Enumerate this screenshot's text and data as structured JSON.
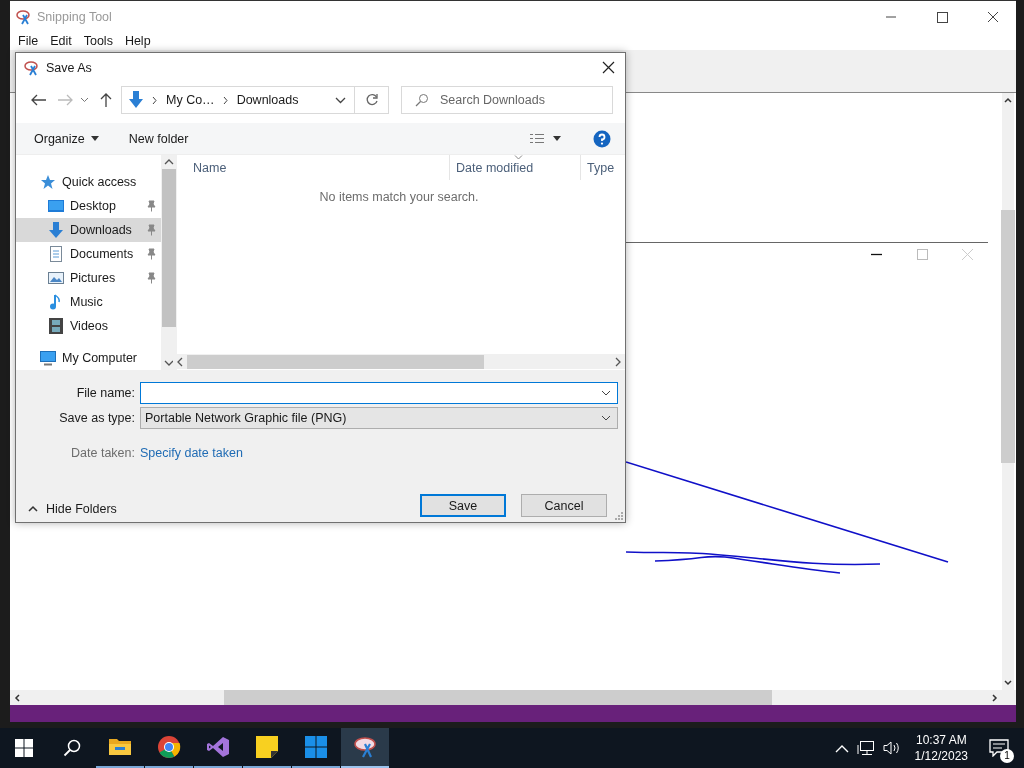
{
  "app_window": {
    "title": "Snipping Tool",
    "menu": [
      "File",
      "Edit",
      "Tools",
      "Help"
    ]
  },
  "dialog": {
    "title": "Save As",
    "address": {
      "crumbs": [
        "My Co…",
        "Downloads"
      ]
    },
    "search": {
      "placeholder": "Search Downloads"
    },
    "commands": {
      "organize": "Organize",
      "new_folder": "New folder"
    },
    "nav_items": [
      {
        "label": "Quick access",
        "kind": "star",
        "pinned": false,
        "selected": false,
        "children": [
          {
            "label": "Desktop",
            "kind": "desktop",
            "pinned": true,
            "selected": false
          },
          {
            "label": "Downloads",
            "kind": "downloads",
            "pinned": true,
            "selected": true
          },
          {
            "label": "Documents",
            "kind": "documents",
            "pinned": true,
            "selected": false
          },
          {
            "label": "Pictures",
            "kind": "pictures",
            "pinned": true,
            "selected": false
          },
          {
            "label": "Music",
            "kind": "music",
            "pinned": false,
            "selected": false
          },
          {
            "label": "Videos",
            "kind": "videos",
            "pinned": false,
            "selected": false
          }
        ]
      },
      {
        "label": "My Computer",
        "kind": "computer",
        "pinned": false,
        "selected": false
      }
    ],
    "columns": [
      {
        "label": "Name",
        "sorted": false
      },
      {
        "label": "Date modified",
        "sorted": true
      },
      {
        "label": "Type",
        "sorted": false
      }
    ],
    "empty_message": "No items match your search.",
    "file_name": {
      "label": "File name:",
      "focused": true
    },
    "save_as_type": {
      "label": "Save as type:",
      "value": "Portable Network Graphic file (PNG)"
    },
    "date_taken": {
      "label": "Date taken:",
      "link": "Specify date taken"
    },
    "hide_folders": "Hide Folders",
    "buttons": [
      {
        "label": "Save",
        "default": true
      },
      {
        "label": "Cancel",
        "default": false
      }
    ]
  },
  "taskbar": {
    "apps": [
      {
        "kind": "explorer",
        "active": false
      },
      {
        "kind": "chrome",
        "active": false
      },
      {
        "kind": "studio",
        "active": false
      },
      {
        "kind": "notes",
        "active": false
      },
      {
        "kind": "tiles",
        "active": false
      },
      {
        "kind": "snip",
        "active": true
      }
    ],
    "time": "10:37 AM",
    "date": "1/12/2023",
    "notifications": "1"
  }
}
